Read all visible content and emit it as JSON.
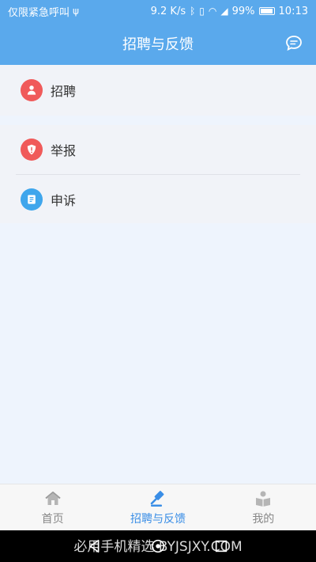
{
  "status_bar": {
    "carrier_text": "仅限紧急呼叫",
    "network_speed": "9.2 K/s",
    "battery_percent": "99%",
    "time": "10:13"
  },
  "header": {
    "title": "招聘与反馈"
  },
  "menu": {
    "recruit_label": "招聘",
    "report_label": "举报",
    "appeal_label": "申诉"
  },
  "tabs": {
    "home_label": "首页",
    "recruit_feedback_label": "招聘与反馈",
    "mine_label": "我的"
  },
  "watermark": {
    "text": "必用手机精选  BYJSJXY.COM"
  },
  "colors": {
    "primary": "#5aa9ec",
    "active_tab": "#3a8ee6",
    "red_icon": "#f05a5a",
    "blue_icon": "#3fa6ec"
  }
}
